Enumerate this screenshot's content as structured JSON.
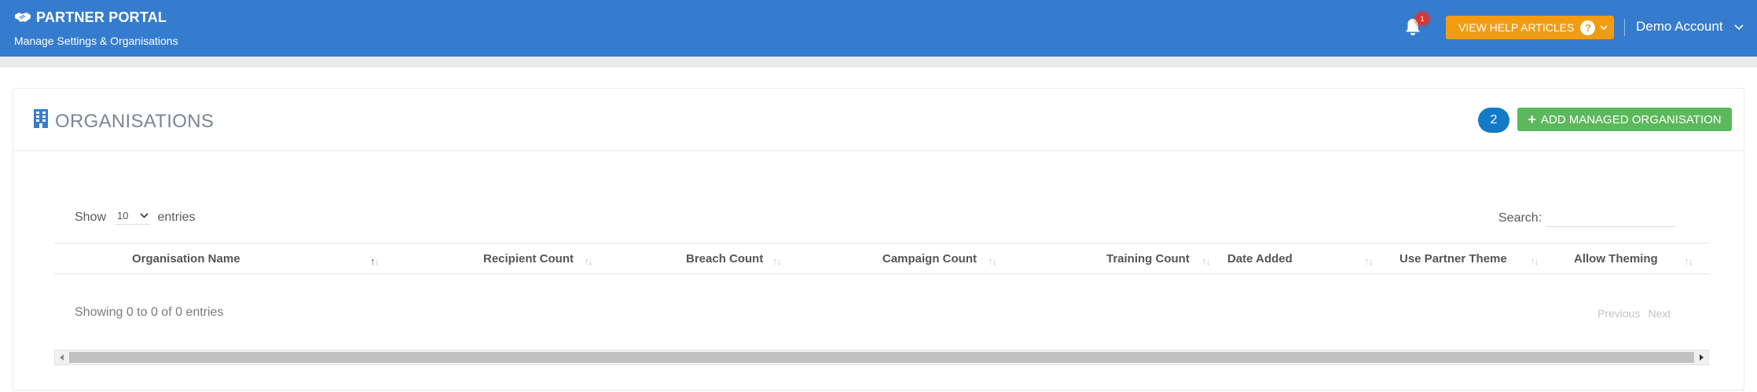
{
  "header": {
    "title": "PARTNER PORTAL",
    "subtitle": "Manage Settings & Organisations",
    "notification_count": "1",
    "help_button_label": "VIEW HELP ARTICLES",
    "help_icon_glyph": "?",
    "account_name": "Demo Account",
    "bg_color": "#357cce",
    "help_color": "#f39c12"
  },
  "page": {
    "title": "ORGANISATIONS",
    "count_badge": "2",
    "add_button_label": "ADD MANAGED ORGANISATION",
    "add_button_color": "#5cb85c"
  },
  "table": {
    "show_label": "Show",
    "page_size": "10",
    "entries_label": "entries",
    "search_label": "Search:",
    "search_value": "",
    "columns": [
      "Organisation Name",
      "Recipient Count",
      "Breach Count",
      "Campaign Count",
      "Training Count",
      "Date Added",
      "Use Partner Theme",
      "Allow Theming"
    ],
    "info": "Showing 0 to 0 of 0 entries",
    "previous_label": "Previous",
    "next_label": "Next"
  }
}
